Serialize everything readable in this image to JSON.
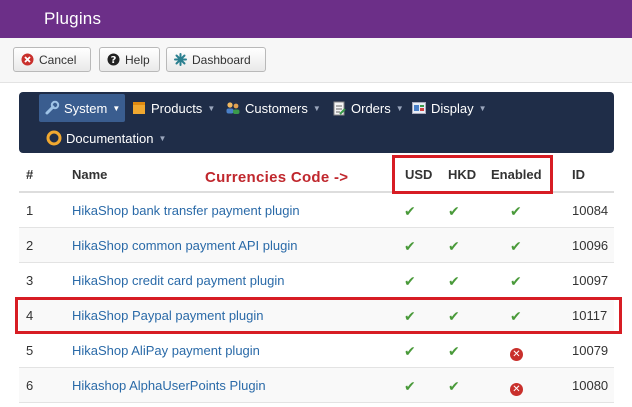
{
  "page": {
    "title": "Plugins"
  },
  "toolbar": {
    "cancel_label": "Cancel",
    "help_label": "Help",
    "dashboard_label": "Dashboard"
  },
  "menu": {
    "items": [
      {
        "label": "System",
        "icon": "wrench-icon"
      },
      {
        "label": "Products",
        "icon": "box-icon"
      },
      {
        "label": "Customers",
        "icon": "users-icon"
      },
      {
        "label": "Orders",
        "icon": "clipboard-icon"
      },
      {
        "label": "Display",
        "icon": "display-icon"
      },
      {
        "label": "Documentation",
        "icon": "lifebuoy-icon"
      }
    ]
  },
  "annotation": {
    "label": "Currencies Code ->"
  },
  "table": {
    "columns": {
      "num": "#",
      "name": "Name",
      "usd": "USD",
      "hkd": "HKD",
      "enabled": "Enabled",
      "id": "ID"
    },
    "rows": [
      {
        "num": "1",
        "name": "HikaShop bank transfer payment plugin",
        "usd": true,
        "hkd": true,
        "enabled": true,
        "id": "10084"
      },
      {
        "num": "2",
        "name": "HikaShop common payment API plugin",
        "usd": true,
        "hkd": true,
        "enabled": true,
        "id": "10096"
      },
      {
        "num": "3",
        "name": "HikaShop credit card payment plugin",
        "usd": true,
        "hkd": true,
        "enabled": true,
        "id": "10097"
      },
      {
        "num": "4",
        "name": "HikaShop Paypal payment plugin",
        "usd": true,
        "hkd": true,
        "enabled": true,
        "id": "10117"
      },
      {
        "num": "5",
        "name": "HikaShop AliPay payment plugin",
        "usd": true,
        "hkd": true,
        "enabled": false,
        "id": "10079"
      },
      {
        "num": "6",
        "name": "Hikashop AlphaUserPoints Plugin",
        "usd": true,
        "hkd": true,
        "enabled": false,
        "id": "10080"
      }
    ]
  },
  "colors": {
    "header": "#6c2f88",
    "menubar": "#1f2d48",
    "highlight": "#d71d24",
    "check": "#4a9a3a",
    "cross": "#c9302c",
    "link": "#2a6aa8"
  }
}
